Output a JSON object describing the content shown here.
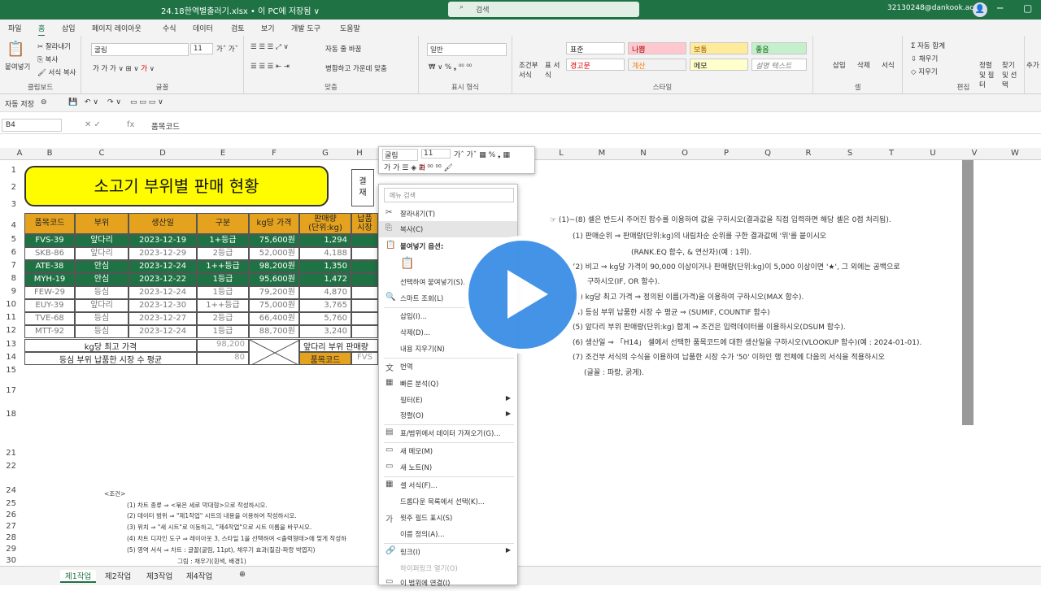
{
  "titlebar": {
    "filename": "24.18한역별출러기.xlsx • 이 PC에 저장됨 ∨",
    "search_placeholder": "검색",
    "account": "32130248@dankook.ac.kr",
    "avatar": "👤"
  },
  "menu": [
    "파일",
    "홈",
    "삽입",
    "페이지 레이아웃",
    "수식",
    "데이터",
    "검토",
    "보기",
    "개발 도구",
    "도움말"
  ],
  "ribbon": {
    "clipboard": {
      "label": "클립보드",
      "paste": "붙여넣기",
      "cut": "잘라내기",
      "copy": "복사",
      "format": "서식 복사"
    },
    "font": {
      "label": "글꼴",
      "name": "굴림",
      "size": "11"
    },
    "align": {
      "label": "맞춤",
      "wrap": "자동 줄 바꿈",
      "merge": "병합하고 가운데 맞춤"
    },
    "number": {
      "label": "표시 형식",
      "format": "일반"
    },
    "styles": {
      "label": "스타일",
      "cond": "조건부 서식",
      "table": "표 서식",
      "cells": [
        "표준",
        "나쁨",
        "보통",
        "좋음",
        "경고문",
        "계산",
        "메모",
        "설명 텍스트"
      ]
    },
    "cells_group": {
      "label": "셀",
      "insert": "삽입",
      "delete": "삭제",
      "format": "서식"
    },
    "edit": {
      "label": "편집",
      "autosum": "자동 합계",
      "fill": "채우기",
      "clear": "지우기",
      "sort": "정렬 및 필터",
      "find": "찾기 및 선택"
    },
    "more": "추가"
  },
  "qat": {
    "autosave": "자동 저장"
  },
  "formula": {
    "namebox": "B4",
    "fx": "fx",
    "content": "품목코드"
  },
  "columns": [
    "A",
    "B",
    "C",
    "D",
    "E",
    "F",
    "G",
    "H",
    "L",
    "M",
    "N",
    "O",
    "P",
    "Q",
    "R",
    "S",
    "T",
    "U",
    "V",
    "W"
  ],
  "rows": [
    "1",
    "2",
    "3",
    "4",
    "5",
    "6",
    "7",
    "8",
    "9",
    "10",
    "11",
    "12",
    "13",
    "14",
    "15",
    "17",
    "18",
    "21",
    "22",
    "24",
    "25",
    "26",
    "27",
    "28",
    "29",
    "30",
    "31",
    "32"
  ],
  "sheet": {
    "title": "소고기 부위별 판매 현황",
    "approve": [
      "결",
      "재"
    ],
    "headers": [
      "품목코드",
      "부위",
      "생산일",
      "구분",
      "kg당 가격",
      "판매량\n(단위:kg)",
      "납품\n시장"
    ],
    "data": [
      [
        "FVS-39",
        "앞다리",
        "2023-12-19",
        "1+등급",
        "75,600원",
        "1,294"
      ],
      [
        "SKB-86",
        "앞다리",
        "2023-12-29",
        "2등급",
        "52,000원",
        "4,188"
      ],
      [
        "ATE-38",
        "안심",
        "2023-12-24",
        "1++등급",
        "98,200원",
        "1,350"
      ],
      [
        "MYH-19",
        "안심",
        "2023-12-22",
        "1등급",
        "95,600원",
        "1,472"
      ],
      [
        "FEW-29",
        "등심",
        "2023-12-24",
        "1등급",
        "79,200원",
        "4,870"
      ],
      [
        "EUY-39",
        "앞다리",
        "2023-12-30",
        "1++등급",
        "75,000원",
        "3,765"
      ],
      [
        "TVE-68",
        "등심",
        "2023-12-27",
        "2등급",
        "66,400원",
        "5,760"
      ],
      [
        "MTT-92",
        "등심",
        "2023-12-24",
        "1등급",
        "88,700원",
        "3,240"
      ]
    ],
    "r13_label": "kg당 최고 가격",
    "r13_val": "98,200",
    "r13_g": "앞다리 부위 판매량",
    "r14_label": "등심 부위 납품한 시장 수 평균",
    "r14_val": "80",
    "r14_g": "품목코드",
    "r14_h": "FVS"
  },
  "notes": [
    "☞ (1)~(8) 셀은 반드시 주어진 함수를 이용하여 값을 구하시오(결과값을 직접 입력하면 해당 셀은 0점 처리됨).",
    "(1) 판매순위 ⇒ 판매량(단위:kg)의 내림차순 순위를 구한 결과값에 '위'를 붙이시오",
    "(RANK.EQ 함수, & 연산자)(예 : 1위).",
    "(2) 비고 ⇒ kg당 가격이 90,000 이상이거나 판매량(단위:kg)이 5,000 이상이면 '★', 그 외에는 공백으로",
    "구하시오(IF, OR 함수).",
    "(3) kg당 최고 가격 ⇒ 정의된 이름(가격)을 이용하여 구하시오(MAX 함수).",
    "(4) 등심 부위 납품한 시장 수 평균 ⇒ (SUMIF, COUNTIF 함수)",
    "(5) 앞다리 부위 판매량(단위:kg) 합계 ⇒ 조건은 입력데이터를 이용하시오(DSUM 함수).",
    "(6) 생산일 ⇒ 「H14」 셀에서 선택한 품목코드에 대한 생산일을 구하시오(VLOOKUP 함수)(예 : 2024-01-01).",
    "(7) 조건부 서식의 수식을 이용하여 납품한 시장 수가 '50' 이하인 행 전체에 다음의 서식을 적용하시오",
    "(글꼴 : 파랑, 굵게)."
  ],
  "conditions": [
    "<조건>",
    "(1) 차트 종류 ⇒ <묶은 세로 막대형>으로 작성하시오.",
    "(2) 데이터 범위 ⇒ \"제1작업\" 시트의 내용을 이용하여 작성하시오.",
    "(3) 위치 ⇒ \"새 시트\"로 이동하고, \"제4작업\"으로 시트 이름을 바꾸시오.",
    "(4) 차트 디자인 도구 ⇒ 레이아웃 3, 스타일 1을 선택하여 <출력형태>에 맞게 작성하",
    "(5) 영역 서식 ⇒ 차트 : 글꼴(굴림, 11pt), 채우기 효과(질감-파랑 박엽지)",
    "그림 : 채우기(흰색, 배경1)"
  ],
  "tabs": [
    "제1작업",
    "제2작업",
    "제3작업",
    "제4작업",
    "⊕"
  ],
  "mini_toolbar": {
    "font": "굴림",
    "size": "11"
  },
  "context_menu": {
    "search": "메뉴 검색",
    "items": [
      {
        "icon": "✂",
        "label": "잘라내기(T)"
      },
      {
        "icon": "⎘",
        "label": "복사(C)"
      },
      {
        "icon": "📋",
        "label": "붙여넣기 옵션:"
      },
      {
        "icon": "",
        "label": "선택하여 붙여넣기(S)..."
      },
      {
        "icon": "🔍",
        "label": "스마트 조회(L)"
      },
      {
        "icon": "",
        "label": "삽입(I)..."
      },
      {
        "icon": "",
        "label": "삭제(D)..."
      },
      {
        "icon": "",
        "label": "내용 지우기(N)"
      },
      {
        "icon": "文",
        "label": "번역"
      },
      {
        "icon": "▦",
        "label": "빠른 분석(Q)"
      },
      {
        "icon": "",
        "label": "필터(E)"
      },
      {
        "icon": "",
        "label": "정렬(O)"
      },
      {
        "icon": "▤",
        "label": "표/범위에서 데이터 가져오기(G)..."
      },
      {
        "icon": "▭",
        "label": "새 메모(M)"
      },
      {
        "icon": "▭",
        "label": "새 노트(N)"
      },
      {
        "icon": "▦",
        "label": "셀 서식(F)..."
      },
      {
        "icon": "",
        "label": "드롭다운 목록에서 선택(K)..."
      },
      {
        "icon": "가",
        "label": "윗주 필드 표시(S)"
      },
      {
        "icon": "",
        "label": "이름 정의(A)..."
      },
      {
        "icon": "🔗",
        "label": "링크(I)"
      },
      {
        "icon": "",
        "label": "하이퍼링크 열기(O)"
      },
      {
        "icon": "",
        "label": "이 범위에 연결(I)"
      }
    ]
  },
  "colors": {
    "brand": "#1f7244",
    "title_fill": "#fffc00",
    "header_fill": "#e5a21f",
    "row_fill": "#1f7244"
  }
}
